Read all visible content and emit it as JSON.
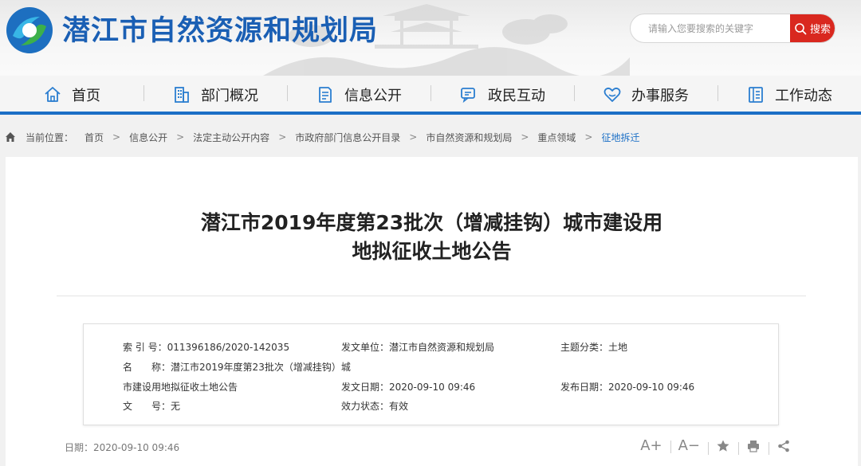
{
  "header": {
    "site_title": "潜江市自然资源和规划局",
    "search_placeholder": "请输入您要搜索的关键字",
    "search_label": "搜索"
  },
  "nav": [
    {
      "label": "首页",
      "icon": "home-icon"
    },
    {
      "label": "部门概况",
      "icon": "building-icon"
    },
    {
      "label": "信息公开",
      "icon": "document-icon"
    },
    {
      "label": "政民互动",
      "icon": "chat-icon"
    },
    {
      "label": "办事服务",
      "icon": "heart-service-icon"
    },
    {
      "label": "工作动态",
      "icon": "list-icon"
    }
  ],
  "breadcrumb": {
    "prefix": "当前位置：",
    "items": [
      "首页",
      "信息公开",
      "法定主动公开内容",
      "市政府部门信息公开目录",
      "市自然资源和规划局",
      "重点领域",
      "征地拆迁"
    ]
  },
  "article": {
    "title_line1": "潜江市2019年度第23批次（增减挂钩）城市建设用",
    "title_line2": "地拟征收土地公告"
  },
  "meta": {
    "index_label": "索 引 号：",
    "index_value": "011396186/2020-142035",
    "issuer_label": "发文单位：",
    "issuer_value": "潜江市自然资源和规划局",
    "topic_label": "主题分类：",
    "topic_value": "土地",
    "name_label": "名　　称：",
    "name_value_line1": "潜江市2019年度第23批次（增减挂钩）城",
    "name_value_line2": "市建设用地拟征收土地公告",
    "issue_date_label": "发文日期：",
    "issue_date_value": "2020-09-10 09:46",
    "publish_date_label": "发布日期：",
    "publish_date_value": "2020-09-10 09:46",
    "doc_no_label": "文　　号：",
    "doc_no_value": "无",
    "status_label": "效力状态：",
    "status_value": "有效"
  },
  "footer": {
    "date": "日期：2020-09-10 09:46",
    "font_increase": "A+",
    "font_decrease": "A−"
  },
  "colors": {
    "brand_blue": "#1b6fc6",
    "search_red": "#d9281f"
  }
}
